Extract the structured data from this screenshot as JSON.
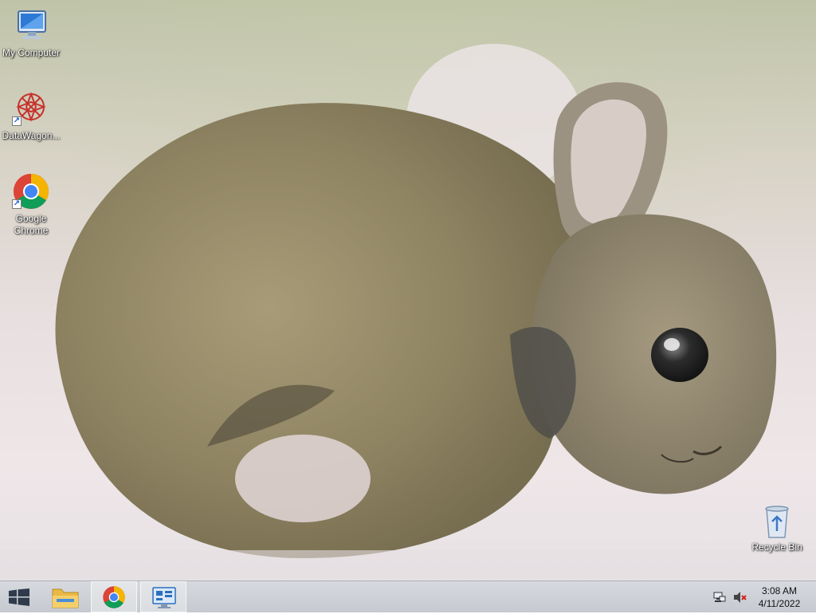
{
  "desktop": {
    "icons": [
      {
        "label": "My Computer",
        "icon": "my-computer-icon"
      },
      {
        "label": "DataWagon...",
        "icon": "datawagon-icon"
      },
      {
        "label": "Google Chrome",
        "icon": "chrome-icon"
      },
      {
        "label": "Recycle Bin",
        "icon": "recycle-bin-icon"
      }
    ]
  },
  "taskbar": {
    "start": "windows-logo-icon",
    "pinned": [
      "file-explorer-icon",
      "chrome-icon",
      "server-manager-icon"
    ],
    "tray_icons": [
      "network-icon",
      "volume-muted-icon"
    ],
    "time": "3:08 AM",
    "date": "4/11/2022"
  },
  "colors": {
    "taskbar": "#ccd0d5",
    "chrome_red": "#db4437",
    "chrome_green": "#0f9d58",
    "chrome_yellow": "#f4b400",
    "chrome_blue": "#4285f4"
  }
}
